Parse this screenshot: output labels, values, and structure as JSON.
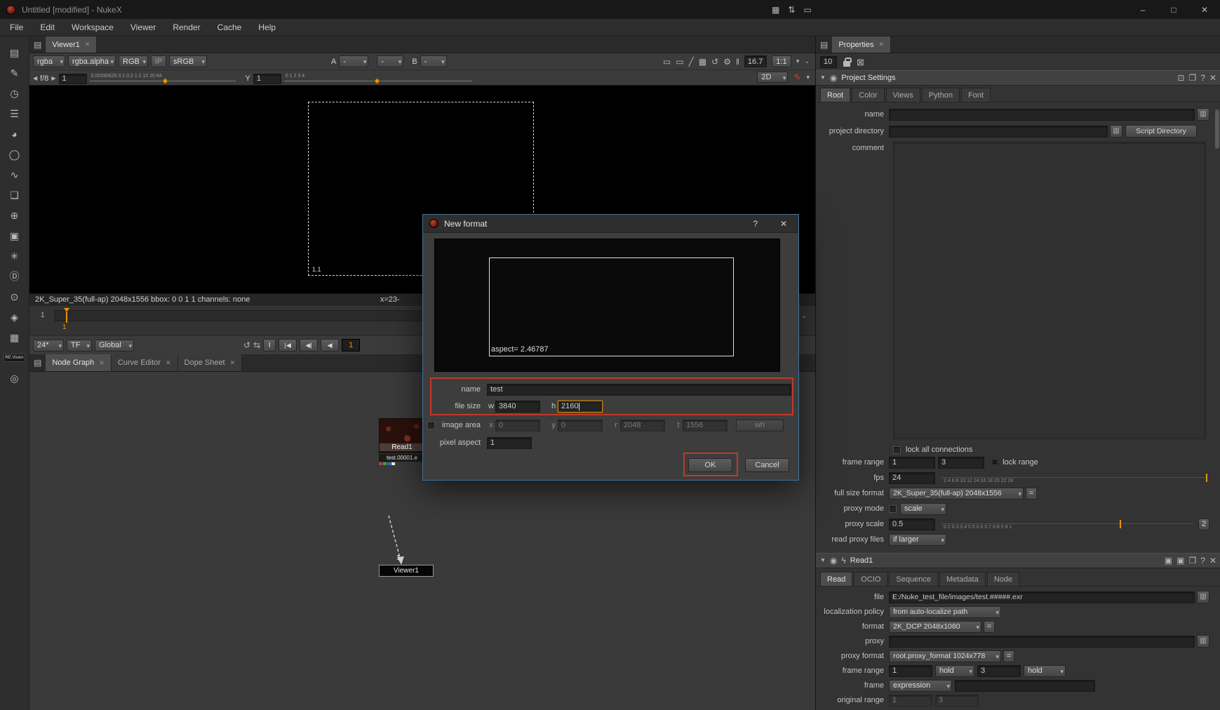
{
  "colors": {
    "accent_orange": "#e8940a",
    "annotation_red": "#bf3a28",
    "focus_orange": "#d98a00",
    "dialog_border_blue": "#41719c"
  },
  "window": {
    "title": "Untitled [modified] - NukeX"
  },
  "menubar": [
    "File",
    "Edit",
    "Workspace",
    "Viewer",
    "Render",
    "Cache",
    "Help"
  ],
  "icons": {
    "chevron_down": "▾",
    "triangle_down": "▼",
    "left_arrow": "◀",
    "right_arrow": "▶",
    "panel_menu": "▤",
    "file_browser": "▥",
    "close": "✕",
    "help": "?",
    "equals": "=",
    "check_x": "✖",
    "float": "❐",
    "center": "⊡",
    "clear_panels": "⊠",
    "refresh": "↺",
    "swap": "⇆",
    "gear": "⚙",
    "pause": "‖",
    "diag": "╱",
    "grid": "▦",
    "monitor": "▭",
    "updown": "⇅",
    "pencil": "✎",
    "node": "◉",
    "lightning": "ϟ",
    "swatch": "▣",
    "double_chevron": "⌄",
    "minimize": "–",
    "maximize": "□"
  },
  "sidebar": {
    "items": [
      {
        "name": "image",
        "glyph": "▤"
      },
      {
        "name": "draw",
        "glyph": "✎"
      },
      {
        "name": "time",
        "glyph": "◷"
      },
      {
        "name": "channel",
        "glyph": "☰"
      },
      {
        "name": "color",
        "glyph": "◕"
      },
      {
        "name": "filter",
        "glyph": "◯"
      },
      {
        "name": "keyer",
        "glyph": "∿"
      },
      {
        "name": "merge",
        "glyph": "❏"
      },
      {
        "name": "transform",
        "glyph": "⊕"
      },
      {
        "name": "3d",
        "glyph": "▣"
      },
      {
        "name": "particles",
        "glyph": "✳"
      },
      {
        "name": "deep",
        "glyph": "Ⓓ"
      },
      {
        "name": "views",
        "glyph": "⊙"
      },
      {
        "name": "toolsets",
        "glyph": "◈"
      },
      {
        "name": "other",
        "glyph": "▦"
      },
      {
        "name": "revision",
        "glyph": "RE.Vision"
      },
      {
        "name": "ocio",
        "glyph": "◎"
      }
    ]
  },
  "viewer": {
    "tab": "Viewer1",
    "channels": "rgba",
    "alpha_channels": "rgba.alpha",
    "display": "RGB",
    "ip": "IP",
    "lut": "sRGB",
    "a_label": "A",
    "a_value": "-",
    "wipe_value": "-",
    "b_label": "B",
    "b_value": "-",
    "fps": "16.7",
    "zoom": "1:1",
    "mode": "2D",
    "fstop": "f/8",
    "gain": "1",
    "gamma_label": "Y",
    "gamma": "1",
    "gain_ticks": "0.00390625 0.1 0.2    1   2      10  20  64",
    "gamma_ticks": "0        1        2        3        4",
    "format_label": "1.1",
    "info_left": "2K_Super_35(full-ap) 2048x1556  bbox: 0 0 1 1  channels: none",
    "info_right": "x=23-"
  },
  "timeline": {
    "start_label": "1",
    "marker_label": "1",
    "fps": "24*",
    "tf": "TF",
    "range": "Global",
    "i": "I",
    "to_start": "|◀",
    "prev_key": "◀|",
    "prev": "◀",
    "frame": "1"
  },
  "docktabs": {
    "tabs": [
      "Node Graph",
      "Curve Editor",
      "Dope Sheet"
    ]
  },
  "nodegraph": {
    "read_name": "Read1",
    "read_file": "test.00001.e",
    "viewer_name": "Viewer1",
    "edge_label": "1"
  },
  "dialog": {
    "title": "New format",
    "aspect_label": "aspect= 2.46787",
    "name_label": "name",
    "name_value": "test",
    "file_size_label": "file size",
    "w_label": "w",
    "w_value": "3840",
    "h_label": "h",
    "h_value": "2160",
    "image_area_label": "image area",
    "x_label": "x",
    "x_value": "0",
    "y_label": "y",
    "y_value": "0",
    "r_label": "r",
    "r_value": "2048",
    "t_label": "t",
    "t_value": "1556",
    "wh_button": "wh",
    "pixel_aspect_label": "pixel aspect",
    "pixel_aspect_value": "1",
    "ok": "OK",
    "cancel": "Cancel"
  },
  "props": {
    "tab": "Properties",
    "max_panels": "10",
    "ps": {
      "title": "Project Settings",
      "tabs": [
        "Root",
        "Color",
        "Views",
        "Python",
        "Font"
      ],
      "name_label": "name",
      "dir_label": "project directory",
      "script_dir_button": "Script Directory",
      "comment_label": "comment",
      "lock_connections": "lock all connections",
      "frame_range_label": "frame range",
      "fr_start": "1",
      "fr_end": "3",
      "lock_range": "lock range",
      "fps_label": "fps",
      "fps": "24",
      "fps_ticks": "2    4    6    8    10    12    14   16   18   20   22  24",
      "full_format_label": "full size format",
      "full_format": "2K_Super_35(full-ap) 2048x1556",
      "proxy_mode_label": "proxy mode",
      "proxy_mode": "scale",
      "proxy_scale_label": "proxy scale",
      "proxy_scale": "0.5",
      "proxy_ticks": "0.2      0.3      0.4     0.5    0.6   0.7  0.8 0.9 1",
      "proxy_max": "2",
      "read_proxy_label": "read proxy files",
      "read_proxy": "if larger"
    },
    "read": {
      "title": "Read1",
      "tabs": [
        "Read",
        "OCIO",
        "Sequence",
        "Metadata",
        "Node"
      ],
      "file_label": "file",
      "file": "E:/Nuke_test_file/images/test.#####.exr",
      "loc_label": "localization policy",
      "loc": "from auto-localize path",
      "format_label": "format",
      "format": "2K_DCP 2048x1080",
      "proxy_label": "proxy",
      "proxy_format_label": "proxy format",
      "proxy_format": "root.proxy_format 1024x778",
      "frame_range_label": "frame range",
      "fr_start": "1",
      "fr_hold1": "hold",
      "fr_end": "3",
      "fr_hold2": "hold",
      "frame_label": "frame",
      "frame_mode": "expression",
      "orig_label": "original range",
      "or_start": "1",
      "or_end": "3"
    }
  }
}
